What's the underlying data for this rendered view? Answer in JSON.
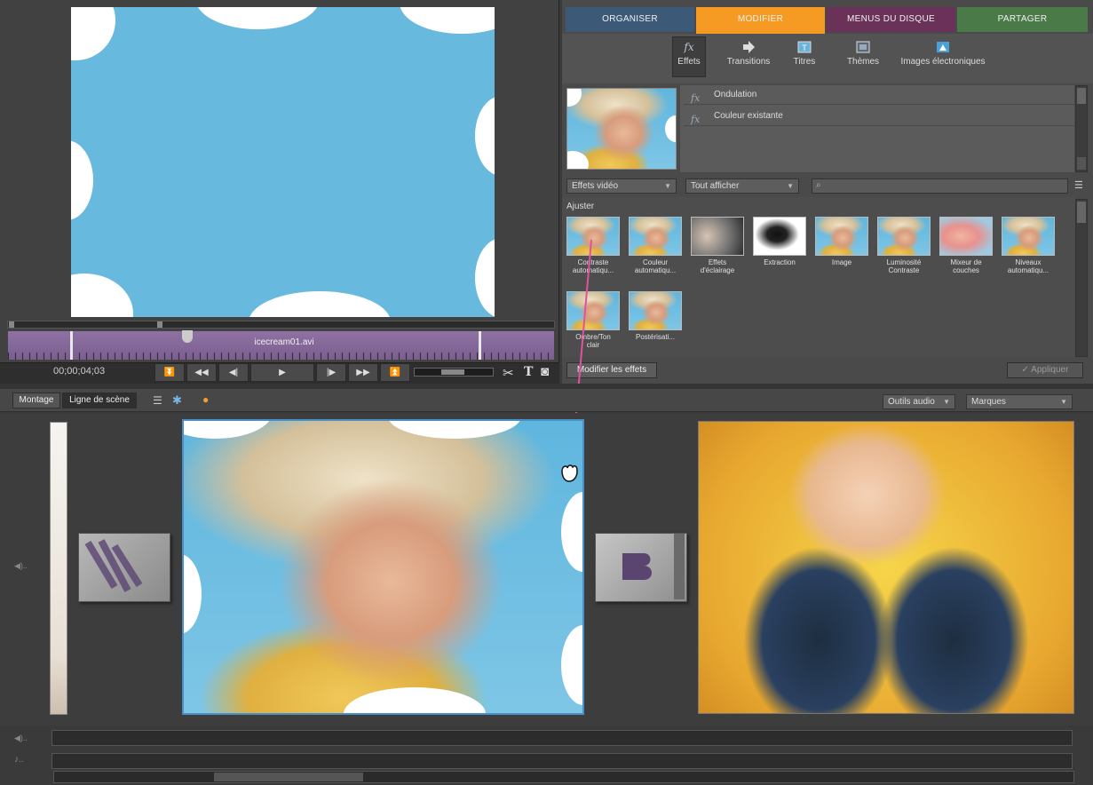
{
  "tabs": [
    {
      "label": "ORGANISER",
      "color": "#3c5a77"
    },
    {
      "label": "MODIFIER",
      "color": "#f59a23"
    },
    {
      "label": "MENUS DU DISQUE",
      "color": "#6a3258"
    },
    {
      "label": "PARTAGER",
      "color": "#4a7a48"
    }
  ],
  "subtabs": [
    {
      "label": "Effets",
      "icon": "fx-icon"
    },
    {
      "label": "Transitions",
      "icon": "transition-arrow-icon"
    },
    {
      "label": "Titres",
      "icon": "title-icon"
    },
    {
      "label": "Thèmes",
      "icon": "theme-icon"
    },
    {
      "label": "Images électroniques",
      "icon": "clipart-icon"
    }
  ],
  "applied_effects": [
    "Ondulation",
    "Couleur existante"
  ],
  "applied_fx_glyph": "fx",
  "filters": {
    "category": "Effets vidéo",
    "show": "Tout afficher",
    "caret": "▼",
    "search_glyph": "⌕",
    "list_glyph": "☰"
  },
  "group_label": "Ajuster",
  "effects": [
    {
      "label1": "Contraste",
      "label2": "automatiqu..."
    },
    {
      "label1": "Couleur",
      "label2": "automatiqu..."
    },
    {
      "label1": "Effets",
      "label2": "d'éclairage"
    },
    {
      "label1": "Extraction",
      "label2": ""
    },
    {
      "label1": "Image",
      "label2": ""
    },
    {
      "label1": "Luminosité",
      "label2": "Contraste"
    },
    {
      "label1": "Mixeur de",
      "label2": "couches"
    },
    {
      "label1": "Niveaux",
      "label2": "automatiqu..."
    },
    {
      "label1": "Ombre/Ton",
      "label2": "clair"
    },
    {
      "label1": "Postérisati...",
      "label2": ""
    }
  ],
  "buttons": {
    "edit_effects": "Modifier les effets",
    "apply": "Appliquer",
    "apply_check": "✓"
  },
  "monitor": {
    "clip_name": "icecream01.avi",
    "timecode": "00;00;04;03"
  },
  "transport": [
    {
      "glyph": "⏬",
      "name": "set-in-icon"
    },
    {
      "glyph": "◀◀",
      "name": "rewind-icon"
    },
    {
      "glyph": "◀|",
      "name": "step-back-icon"
    },
    {
      "glyph": "▶",
      "name": "play-icon"
    },
    {
      "glyph": "|▶",
      "name": "step-forward-icon"
    },
    {
      "glyph": "▶▶",
      "name": "fast-forward-icon"
    },
    {
      "glyph": "⏫",
      "name": "set-out-icon"
    }
  ],
  "tools": {
    "scissors": "✂",
    "text": "T",
    "camera": "◙"
  },
  "timeline": {
    "view_montage": "Montage",
    "view_scene": "Ligne de scène",
    "audio_tools": "Outils audio",
    "markers": "Marques",
    "icons": {
      "list": "☰",
      "effects": "✱",
      "sticker": "●"
    }
  },
  "audio_rows": {
    "narration": "◀)..",
    "soundtrack": "♪.."
  }
}
